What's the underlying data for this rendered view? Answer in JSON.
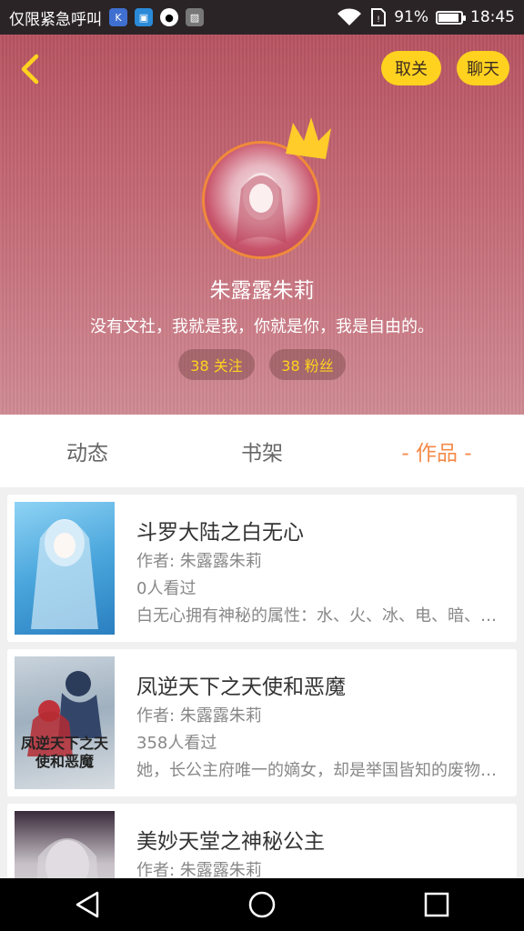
{
  "status_bar": {
    "carrier": "仅限紧急呼叫",
    "battery_text": "91%",
    "battery_level": 0.91,
    "time": "18:45",
    "icons": [
      "k-app-icon",
      "launcher-app-icon",
      "qq-icon",
      "image-icon",
      "wifi-icon",
      "sim-icon",
      "battery-icon"
    ]
  },
  "header": {
    "unfollow_label": "取关",
    "chat_label": "聊天",
    "username": "朱露露朱莉",
    "bio": "没有文社，我就是我，你就是你，我是自由的。",
    "following": "38 关注",
    "fans": "38 粉丝"
  },
  "tabs": [
    {
      "label": "动态",
      "active": false
    },
    {
      "label": "书架",
      "active": false
    },
    {
      "label": "- 作品 -",
      "active": true
    }
  ],
  "books": [
    {
      "title": "斗罗大陆之白无心",
      "author": "作者: 朱露露朱莉",
      "readers": "0人看过",
      "description": "白无心拥有神秘的属性：水、火、冰、电、暗、光、风、土"
    },
    {
      "title": "凤逆天下之天使和恶魔",
      "author": "作者: 朱露露朱莉",
      "readers": "358人看过",
      "description": "她，长公主府唯一的嫡女，却是举国皆知的废物草包",
      "cover_text": "凤逆天下之天使和恶魔"
    },
    {
      "title": "美妙天堂之神秘公主",
      "author": "作者: 朱露露朱莉",
      "readers": "",
      "description": ""
    }
  ],
  "colors": {
    "accent_orange": "#f58a4a",
    "button_yellow": "#ffd21f",
    "header_pink": "#c46a76"
  }
}
